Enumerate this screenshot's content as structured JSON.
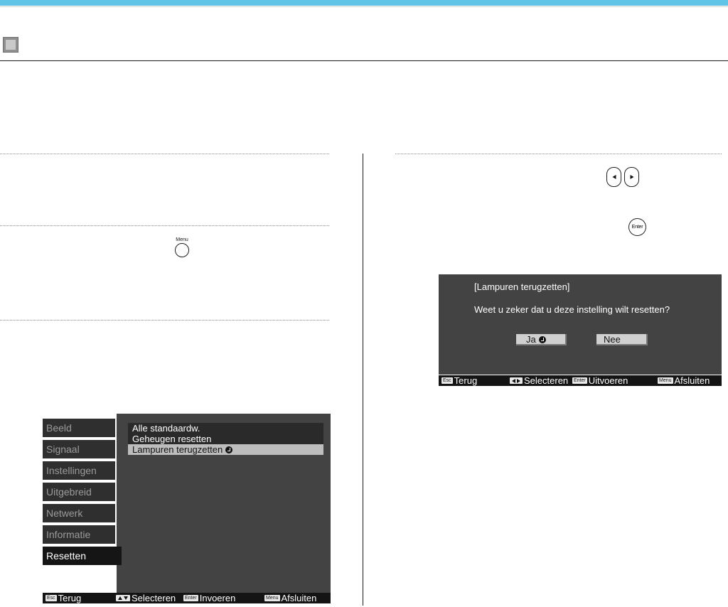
{
  "menu_screen": {
    "tabs": [
      {
        "label": "Beeld"
      },
      {
        "label": "Signaal"
      },
      {
        "label": "Instellingen"
      },
      {
        "label": "Uitgebreid"
      },
      {
        "label": "Netwerk"
      },
      {
        "label": "Informatie"
      },
      {
        "label": "Resetten"
      }
    ],
    "items": [
      {
        "label": "Alle standaardw."
      },
      {
        "label": "Geheugen resetten"
      },
      {
        "label": "Lampuren terugzetten"
      }
    ],
    "footer": {
      "esc_key": "Esc",
      "esc_label": "Terug",
      "select_label": "Selecteren",
      "enter_key": "Enter",
      "enter_label": "Invoeren",
      "menu_key": "Menu",
      "menu_label": "Afsluiten"
    }
  },
  "remote_keys": {
    "menu_key_label": "Menu",
    "enter_key_label": "Enter"
  },
  "confirm_dialog": {
    "title": "[Lampuren terugzetten]",
    "question": "Weet u zeker dat u deze instelling wilt resetten?",
    "yes_label": "Ja",
    "no_label": "Nee",
    "footer": {
      "esc_key": "Esc",
      "esc_label": "Terug",
      "select_label": "Selecteren",
      "enter_key": "Enter",
      "enter_label": "Uitvoeren",
      "menu_key": "Menu",
      "menu_label": "Afsluiten"
    }
  },
  "colors": {
    "header_bar": "#5fc4e6",
    "osd_panel": "#434343",
    "osd_tab": "#2f2f2f",
    "osd_selected": "#bdbdbd"
  }
}
